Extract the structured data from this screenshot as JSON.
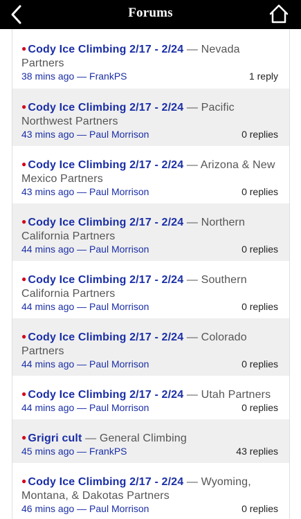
{
  "header": {
    "title": "Forums",
    "back_icon": "chevron-left-icon",
    "home_icon": "home-icon"
  },
  "colors": {
    "bar": "#000000",
    "link": "#1a2ea6",
    "dot": "#d0021b",
    "alt_row": "#efefef"
  },
  "threads": [
    {
      "title": "Cody Ice Climbing 2/17 - 2/24",
      "separator": " — ",
      "forum": "Nevada Partners",
      "meta": "38 mins ago — FrankPS",
      "replies": "1 reply",
      "new": true
    },
    {
      "title": "Cody Ice Climbing 2/17 - 2/24",
      "separator": " — ",
      "forum": "Pacific Northwest Partners",
      "meta": "43 mins ago — Paul Morrison",
      "replies": "0 replies",
      "new": true
    },
    {
      "title": "Cody Ice Climbing 2/17 - 2/24",
      "separator": " — ",
      "forum": "Arizona & New Mexico Partners",
      "meta": "43 mins ago — Paul Morrison",
      "replies": "0 replies",
      "new": true
    },
    {
      "title": "Cody Ice Climbing 2/17 - 2/24",
      "separator": " — ",
      "forum": "Northern California Partners",
      "meta": "44 mins ago — Paul Morrison",
      "replies": "0 replies",
      "new": true
    },
    {
      "title": "Cody Ice Climbing 2/17 - 2/24",
      "separator": " — ",
      "forum": "Southern California Partners",
      "meta": "44 mins ago — Paul Morrison",
      "replies": "0 replies",
      "new": true
    },
    {
      "title": "Cody Ice Climbing 2/17 - 2/24",
      "separator": " — ",
      "forum": "Colorado Partners",
      "meta": "44 mins ago — Paul Morrison",
      "replies": "0 replies",
      "new": true
    },
    {
      "title": "Cody Ice Climbing 2/17 - 2/24",
      "separator": " — ",
      "forum": "Utah Partners",
      "meta": "44 mins ago — Paul Morrison",
      "replies": "0 replies",
      "new": true
    },
    {
      "title": "Grigri cult",
      "separator": " — ",
      "forum": "General Climbing",
      "meta": "45 mins ago — FrankPS",
      "replies": "43 replies",
      "new": true
    },
    {
      "title": "Cody Ice Climbing 2/17 - 2/24",
      "separator": " — ",
      "forum": "Wyoming, Montana, & Dakotas Partners",
      "meta": "46 mins ago — Paul Morrison",
      "replies": "0 replies",
      "new": true
    }
  ]
}
